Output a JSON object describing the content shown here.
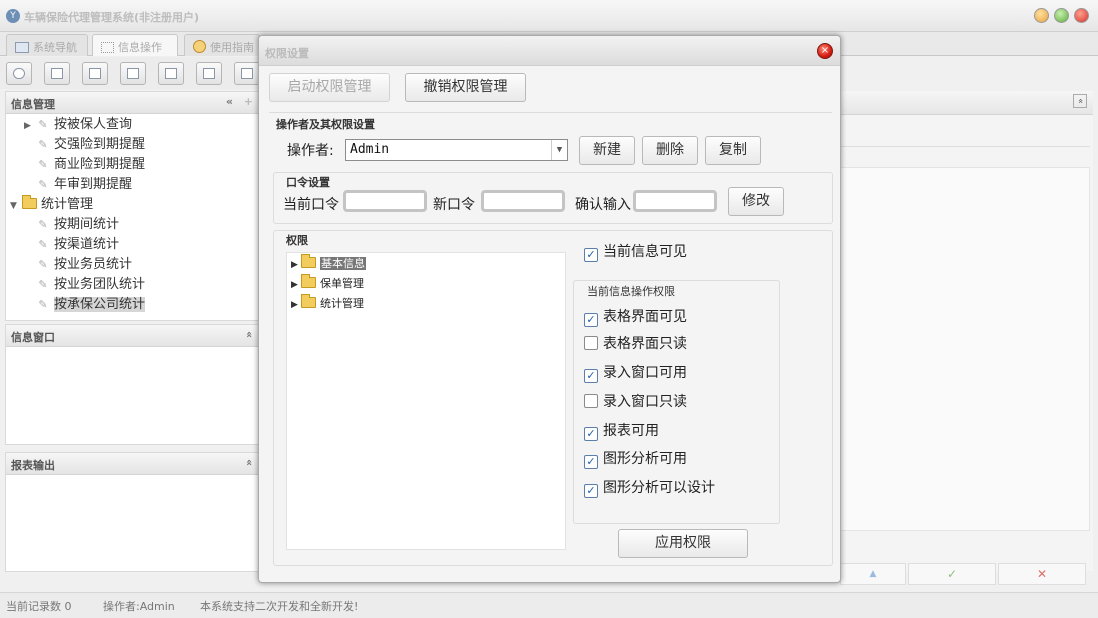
{
  "app": {
    "title": "车辆保险代理管理系统(非注册用户)",
    "icon": "app-logo-icon"
  },
  "tabs": [
    {
      "label": "系统导航",
      "icon": "monitor-icon"
    },
    {
      "label": "信息操作",
      "icon": "grid-icon"
    },
    {
      "label": "使用指南",
      "icon": "help-icon"
    }
  ],
  "toolbar": {
    "buttons": [
      "search-icon",
      "list-icon",
      "document-icon",
      "users-icon",
      "window-icon",
      "export-icon",
      "print-icon"
    ]
  },
  "left_panel": {
    "title": "信息管理",
    "collapse": "«",
    "add": "+",
    "tree": [
      {
        "label": "按被保人查询",
        "level": 1,
        "expander": "▶"
      },
      {
        "label": "交强险到期提醒",
        "level": 1
      },
      {
        "label": "商业险到期提醒",
        "level": 1
      },
      {
        "label": "年审到期提醒",
        "level": 1
      },
      {
        "label": "统计管理",
        "level": 0,
        "expander": "▼"
      },
      {
        "label": "按期间统计",
        "level": 1
      },
      {
        "label": "按渠道统计",
        "level": 1
      },
      {
        "label": "按业务员统计",
        "level": 1
      },
      {
        "label": "按业务团队统计",
        "level": 1
      },
      {
        "label": "按承保公司统计",
        "level": 1,
        "selected": true
      }
    ]
  },
  "info_window": {
    "title": "信息窗口",
    "collapse": "«"
  },
  "report_output": {
    "title": "报表输出",
    "collapse": "«"
  },
  "right_panel": {
    "collapse": "«",
    "actions": [
      "▲",
      "✓",
      "✕"
    ]
  },
  "status": {
    "record_count": "当前记录数 0",
    "operator": "操作者:Admin",
    "notice": "本系统支持二次开发和全新开发!"
  },
  "dialog": {
    "title": "权限设置",
    "close": "×",
    "enable_button": "启动权限管理",
    "revoke_button": "撤销权限管理",
    "operator_section": "操作者及其权限设置",
    "operator_label": "操作者:",
    "operator_value": "Admin",
    "new_button": "新建",
    "delete_button": "删除",
    "copy_button": "复制",
    "password_section": "口令设置",
    "current_password_label": "当前口令",
    "new_password_label": "新口令",
    "confirm_label": "确认输入",
    "modify_button": "修改",
    "permission_section": "权限",
    "perm_tree": [
      {
        "label": "基本信息",
        "selected": true
      },
      {
        "label": "保单管理"
      },
      {
        "label": "统计管理"
      }
    ],
    "current_visible": {
      "label": "当前信息可见",
      "checked": true
    },
    "op_perm_section": "当前信息操作权限",
    "op_perms": [
      {
        "label": "表格界面可见",
        "checked": true
      },
      {
        "label": "表格界面只读",
        "checked": false
      },
      {
        "label": "录入窗口可用",
        "checked": true
      },
      {
        "label": "录入窗口只读",
        "checked": false
      },
      {
        "label": "报表可用",
        "checked": true
      },
      {
        "label": "图形分析可用",
        "checked": true
      },
      {
        "label": "图形分析可以设计",
        "checked": true
      }
    ],
    "apply_button": "应用权限"
  },
  "colors": {
    "close_red": "#d51d10",
    "check_blue": "#1d5fa7",
    "tree_selected": "#777777"
  }
}
